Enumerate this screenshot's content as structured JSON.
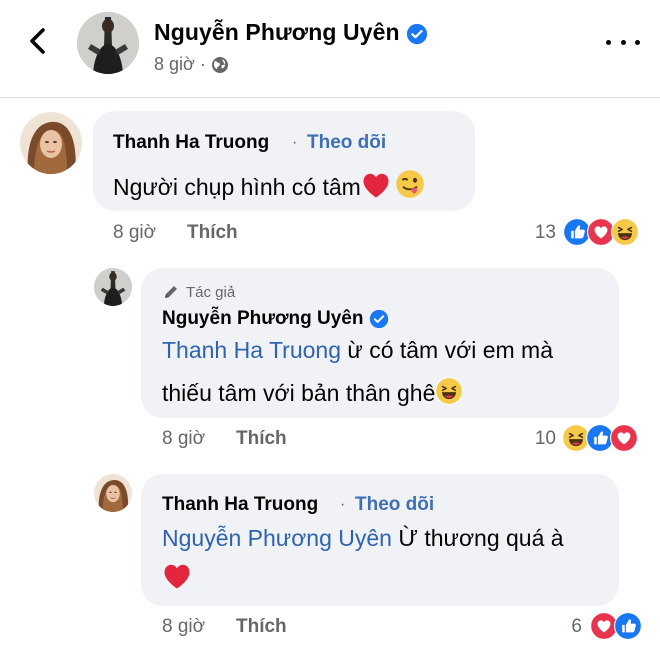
{
  "header": {
    "name": "Nguyễn Phương Uyên",
    "time": "8 giờ"
  },
  "comments": [
    {
      "author": "Thanh Ha Truong",
      "follow": "Theo dõi",
      "text": "Người chụp hình có tâm",
      "time": "8 giờ",
      "like": "Thích",
      "count": "13",
      "reactions": [
        "like-icon",
        "love-icon",
        "haha-icon"
      ]
    },
    {
      "author_tag": "Tác giả",
      "author": "Nguyễn Phương Uyên",
      "mention": "Thanh Ha Truong",
      "text_line1": " ừ  có tâm với em mà",
      "text_line2": "thiếu tâm với bản thân ghê",
      "time": "8 giờ",
      "like": "Thích",
      "count": "10",
      "reactions": [
        "haha-icon",
        "like-icon",
        "love-icon"
      ]
    },
    {
      "author": "Thanh Ha Truong",
      "follow": "Theo dõi",
      "mention": "Nguyễn Phương Uyên",
      "text": " Ừ thương quá à",
      "time": "8 giờ",
      "like": "Thích",
      "count": "6",
      "reactions": [
        "love-icon",
        "like-icon"
      ]
    }
  ],
  "colors": {
    "bubble": "#f0f2f5",
    "link": "#2e63b0",
    "meta": "#65676b",
    "verified": "#1877f2"
  }
}
